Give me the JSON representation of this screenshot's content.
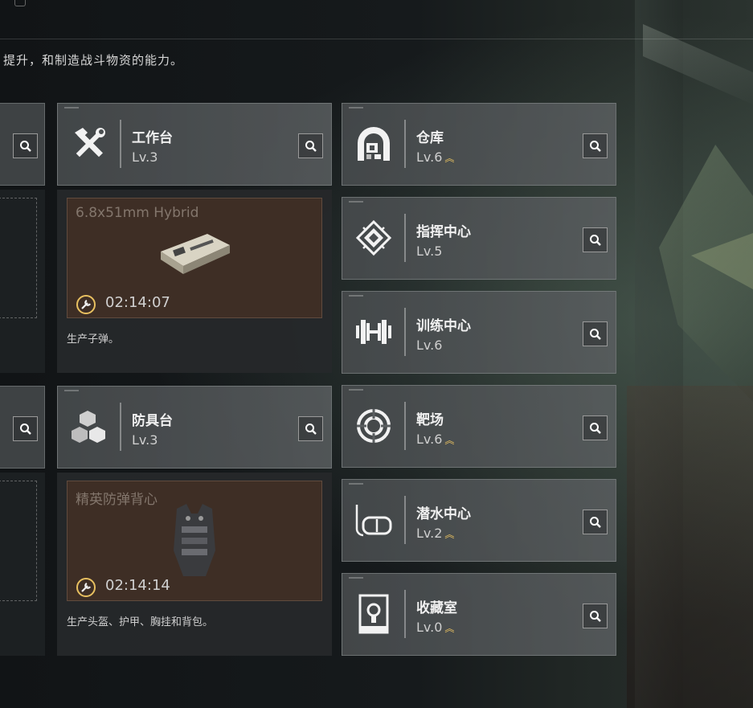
{
  "intro_text": "提升，和制造战斗物资的能力。",
  "workbench": {
    "name": "工作台",
    "level": "Lv.3",
    "icon": "hammer-wrench-icon"
  },
  "armor_bench": {
    "name": "防具台",
    "level": "Lv.3",
    "icon": "cubes-icon"
  },
  "crafts": [
    {
      "item": "6.8x51mm Hybrid",
      "timer": "02:14:07",
      "note": "生产子弹。",
      "image": "ammo-box"
    },
    {
      "item": "精英防弹背心",
      "timer": "02:14:14",
      "note": "生产头盔、护甲、胸挂和背包。",
      "image": "body-armor"
    }
  ],
  "facilities": [
    {
      "name": "仓库",
      "level": "Lv.6",
      "upgradable": true,
      "icon": "vault-icon"
    },
    {
      "name": "指挥中心",
      "level": "Lv.5",
      "upgradable": false,
      "icon": "chip-icon"
    },
    {
      "name": "训练中心",
      "level": "Lv.6",
      "upgradable": false,
      "icon": "dumbbell-icon"
    },
    {
      "name": "靶场",
      "level": "Lv.6",
      "upgradable": true,
      "icon": "target-icon"
    },
    {
      "name": "潜水中心",
      "level": "Lv.2",
      "upgradable": true,
      "icon": "diving-mask-icon"
    },
    {
      "name": "收藏室",
      "level": "Lv.0",
      "upgradable": true,
      "icon": "display-case-icon"
    }
  ],
  "rank_glyph": "︽",
  "colors": {
    "accent": "#e8c060",
    "craft_bg": "#3e2e25"
  }
}
